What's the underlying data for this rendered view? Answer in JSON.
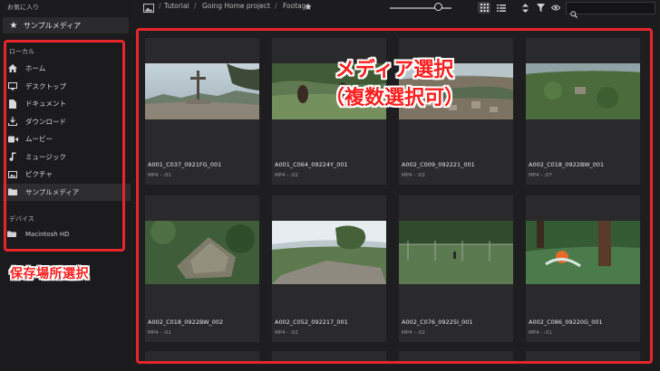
{
  "sidebar": {
    "favorites_header": "お気に入り",
    "favorite_item": {
      "icon": "star-icon",
      "label": "サンプルメディア"
    },
    "local_header": "ローカル",
    "items": [
      {
        "icon": "home-icon",
        "label": "ホーム"
      },
      {
        "icon": "desktop-icon",
        "label": "デスクトップ"
      },
      {
        "icon": "document-icon",
        "label": "ドキュメント"
      },
      {
        "icon": "download-icon",
        "label": "ダウンロード"
      },
      {
        "icon": "movie-icon",
        "label": "ムービー"
      },
      {
        "icon": "music-icon",
        "label": "ミュージック"
      },
      {
        "icon": "picture-icon",
        "label": "ピクチャ"
      },
      {
        "icon": "folder-icon",
        "label": "サンプルメディア",
        "selected": true
      }
    ],
    "devices_header": "デバイス",
    "device_item": {
      "icon": "drive-icon",
      "label": "Macintosh HD"
    }
  },
  "toolbar": {
    "breadcrumb": [
      "Tutorial",
      "Going Home project",
      "Footage"
    ],
    "breadcrumb_separator": "/",
    "thumbnail_size_level": 0.72,
    "search_placeholder": ""
  },
  "annotations": {
    "storage_label": "保存場所選択",
    "media_label_line1": "メディア選択",
    "media_label_line2": "（複数選択可）",
    "box_color": "#e8252a"
  },
  "media": [
    {
      "name": "A001_C037_0921FG_001",
      "meta": "MP4 - :01"
    },
    {
      "name": "A001_C064_09224Y_001",
      "meta": "MP4 - :02"
    },
    {
      "name": "A002_C009_092221_001",
      "meta": "MP4 - :02"
    },
    {
      "name": "A002_C018_0922BW_001",
      "meta": "MP4 - :07"
    },
    {
      "name": "A002_C018_0922BW_002",
      "meta": "MP4 - :01"
    },
    {
      "name": "A002_C052_092217_001",
      "meta": "MP4 - :02"
    },
    {
      "name": "A002_C076_09225I_001",
      "meta": "MP4 - :02"
    },
    {
      "name": "A002_C086_09220G_001",
      "meta": "MP4 - :01"
    }
  ]
}
